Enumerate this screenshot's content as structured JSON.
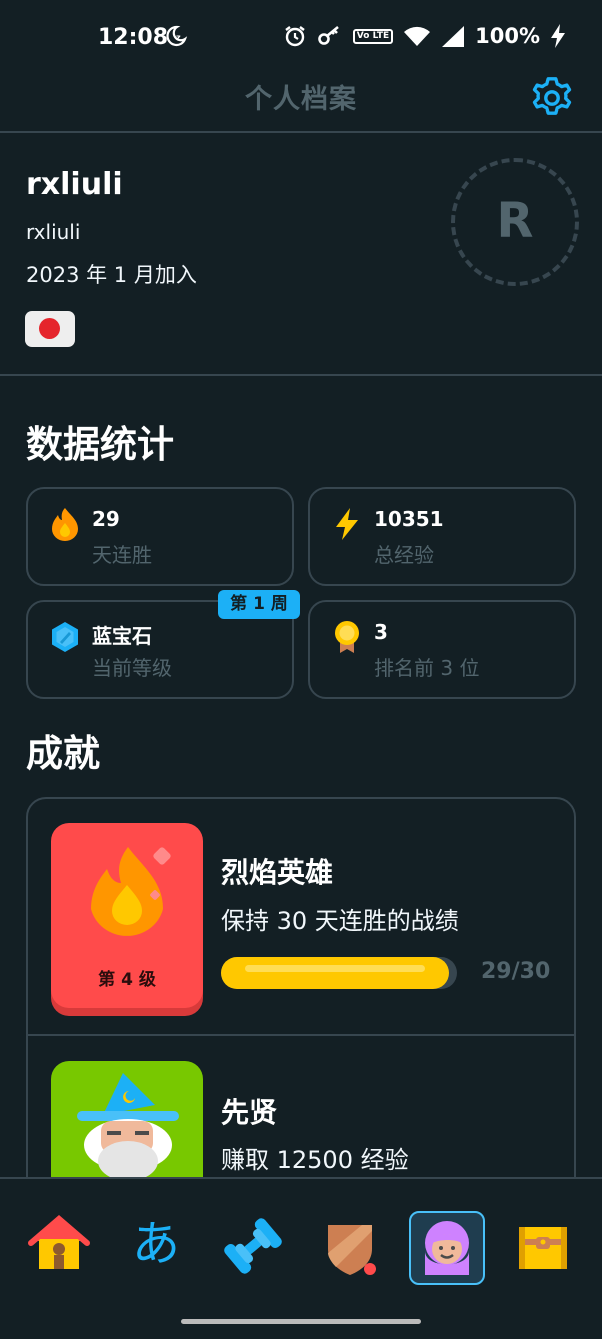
{
  "status_bar": {
    "time": "12:08",
    "volte": "Vo LTE",
    "battery": "100%"
  },
  "header": {
    "title": "个人档案"
  },
  "profile": {
    "display_name": "rxliuli",
    "username": "rxliuli",
    "joined": "2023 年 1 月加入",
    "avatar_initial": "R",
    "flag": "japan-flag"
  },
  "stats": {
    "title": "数据统计",
    "cards": [
      {
        "value": "29",
        "label": "天连胜",
        "icon": "fire-icon"
      },
      {
        "value": "10351",
        "label": "总经验",
        "icon": "lightning-icon"
      },
      {
        "value": "蓝宝石",
        "label": "当前等级",
        "icon": "sapphire-icon",
        "badge": "第 1 周"
      },
      {
        "value": "3",
        "label": "排名前 3 位",
        "icon": "medal-icon"
      }
    ]
  },
  "achievements": {
    "title": "成就",
    "items": [
      {
        "name": "烈焰英雄",
        "desc": "保持 30 天连胜的战绩",
        "level": "第 4 级",
        "progress_text": "29/30",
        "progress": 0.967
      },
      {
        "name": "先贤",
        "desc": "赚取 12500 经验"
      }
    ]
  },
  "bottom_nav": {
    "kana": "あ",
    "items": [
      "home-icon",
      "characters-icon",
      "practice-icon",
      "leagues-icon",
      "profile-icon",
      "shop-icon"
    ],
    "active": "profile-icon"
  },
  "colors": {
    "background": "#131f24",
    "border": "#37464f",
    "muted": "#52656d",
    "accent": "#1cb0f6",
    "gold": "#ffc800",
    "red": "#ff4b4b",
    "green": "#78c800"
  }
}
